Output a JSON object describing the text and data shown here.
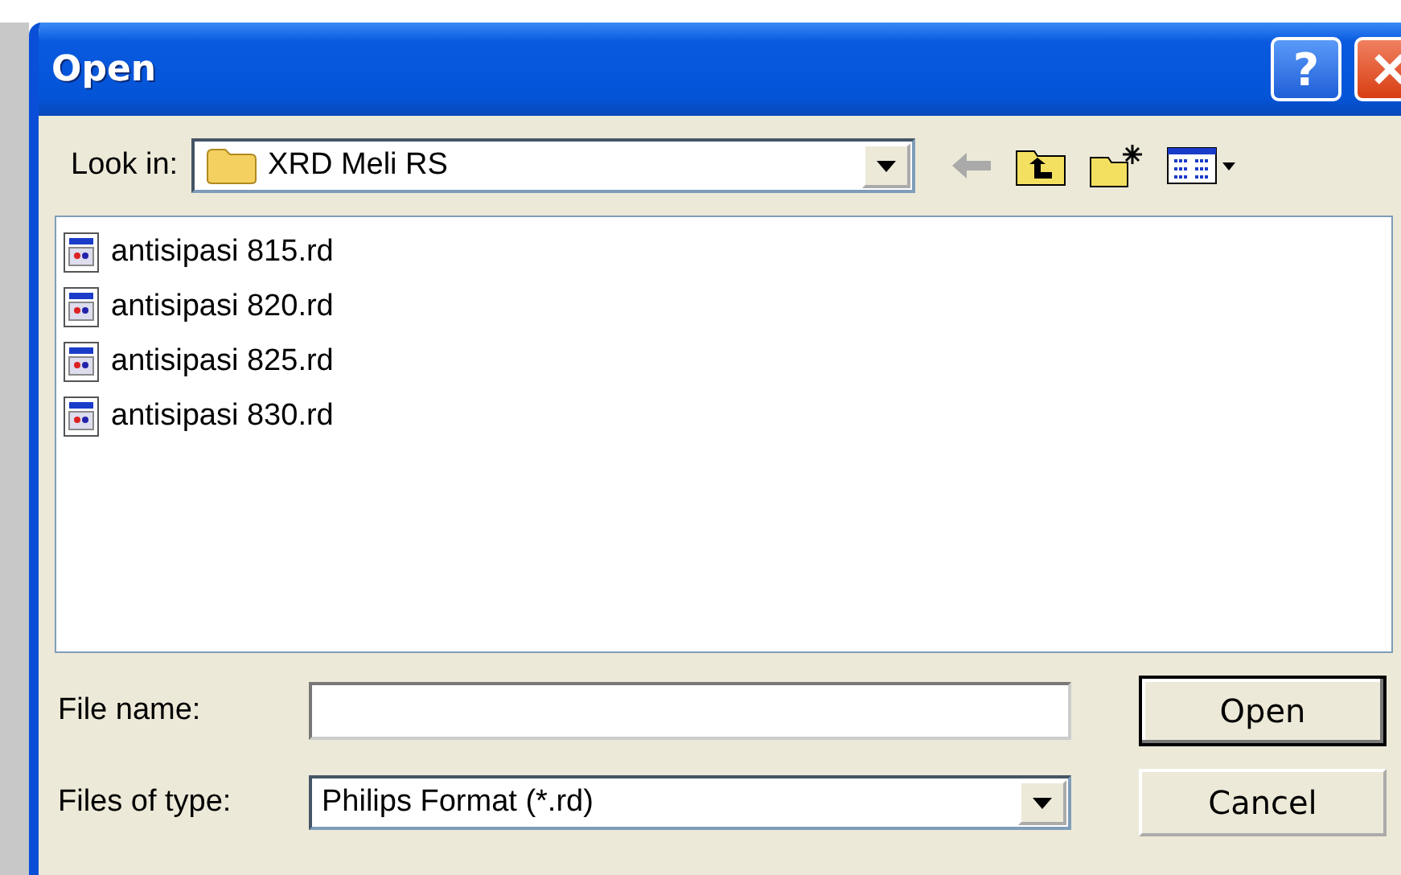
{
  "window": {
    "title": "Open",
    "help_button": "?"
  },
  "look_in": {
    "label": "Look in:",
    "value": "XRD Meli RS"
  },
  "files": [
    {
      "name": "antisipasi 815.rd"
    },
    {
      "name": "antisipasi 820.rd"
    },
    {
      "name": "antisipasi 825.rd"
    },
    {
      "name": "antisipasi 830.rd"
    }
  ],
  "file_name": {
    "label": "File name:"
  },
  "file_type": {
    "label": "Files of type:",
    "value": "Philips Format (*.rd)"
  },
  "buttons": [
    {
      "label": "Open",
      "default": true
    },
    {
      "label": "Cancel",
      "default": false
    }
  ]
}
